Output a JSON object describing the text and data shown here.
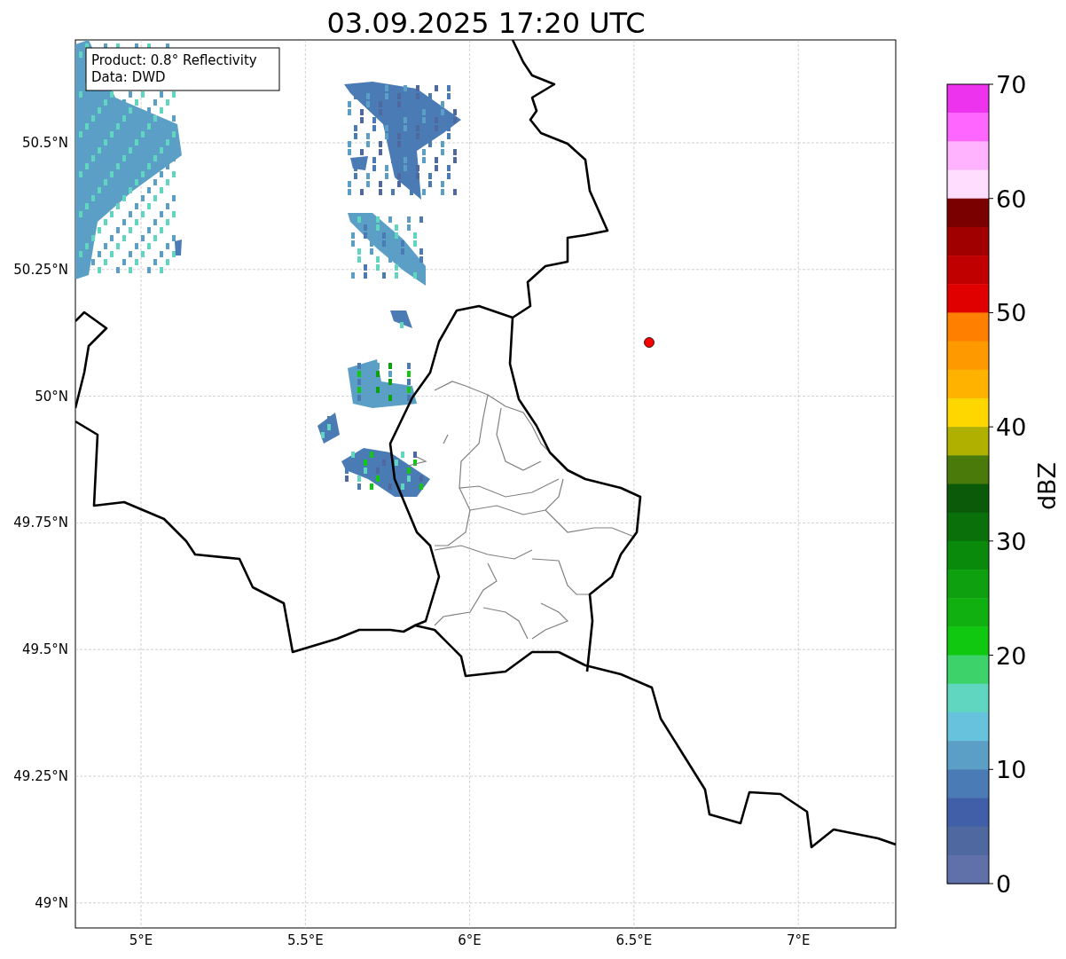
{
  "figure": {
    "title": "03.09.2025 17:20 UTC",
    "info_box": [
      "Product: 0.8° Reflectivity",
      "Data: DWD"
    ],
    "lat_ticks": [
      "50.5°N",
      "50.25°N",
      "50°N",
      "49.75°N",
      "49.5°N",
      "49.25°N",
      "49°N"
    ],
    "lon_ticks": [
      "5°E",
      "5.5°E",
      "6°E",
      "6.5°E",
      "7°E"
    ],
    "colorbar": {
      "label": "dBZ",
      "ticks": [
        "70",
        "60",
        "50",
        "40",
        "30",
        "20",
        "10",
        "0"
      ],
      "segments": [
        {
          "color": "#ee33ee"
        },
        {
          "color": "#ff66ff"
        },
        {
          "color": "#ffb3ff"
        },
        {
          "color": "#ffddff"
        },
        {
          "color": "#7a0000"
        },
        {
          "color": "#a00000"
        },
        {
          "color": "#c00000"
        },
        {
          "color": "#e00000"
        },
        {
          "color": "#ff7f00"
        },
        {
          "color": "#ff9900"
        },
        {
          "color": "#ffb300"
        },
        {
          "color": "#ffd700"
        },
        {
          "color": "#b0b000"
        },
        {
          "color": "#4a7a0a"
        },
        {
          "color": "#0a5a0a"
        },
        {
          "color": "#0a700a"
        },
        {
          "color": "#0a8a0a"
        },
        {
          "color": "#0ea00e"
        },
        {
          "color": "#10b010"
        },
        {
          "color": "#10c810"
        },
        {
          "color": "#3dd36a"
        },
        {
          "color": "#60d6c0"
        },
        {
          "color": "#66c2dd"
        },
        {
          "color": "#5b9fc7"
        },
        {
          "color": "#4a7bb5"
        },
        {
          "color": "#415fa8"
        },
        {
          "color": "#5068a0"
        },
        {
          "color": "#6070a8"
        }
      ]
    }
  }
}
